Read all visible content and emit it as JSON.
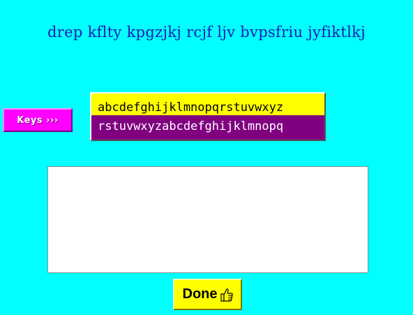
{
  "puzzle": {
    "cipher_text": "drep kflty kpgzjkj rcjf ljv bvpsfriu jyfiktlkj"
  },
  "keys_button": {
    "label": "Keys ›››"
  },
  "key_table": {
    "plain_row": "abcdefghijklmnopqrstuvwxyz",
    "cipher_row": "rstuvwxyzabcdefghijklmnopq",
    "plain_color": "#ffff00",
    "cipher_color": "#800080"
  },
  "answer": {
    "value": "",
    "placeholder": ""
  },
  "done_button": {
    "label": "Done",
    "icon": "thumbs-up-icon"
  },
  "colors": {
    "background": "#00ffff",
    "title": "#1a1ab0",
    "keys_button": "#ff00ff"
  }
}
